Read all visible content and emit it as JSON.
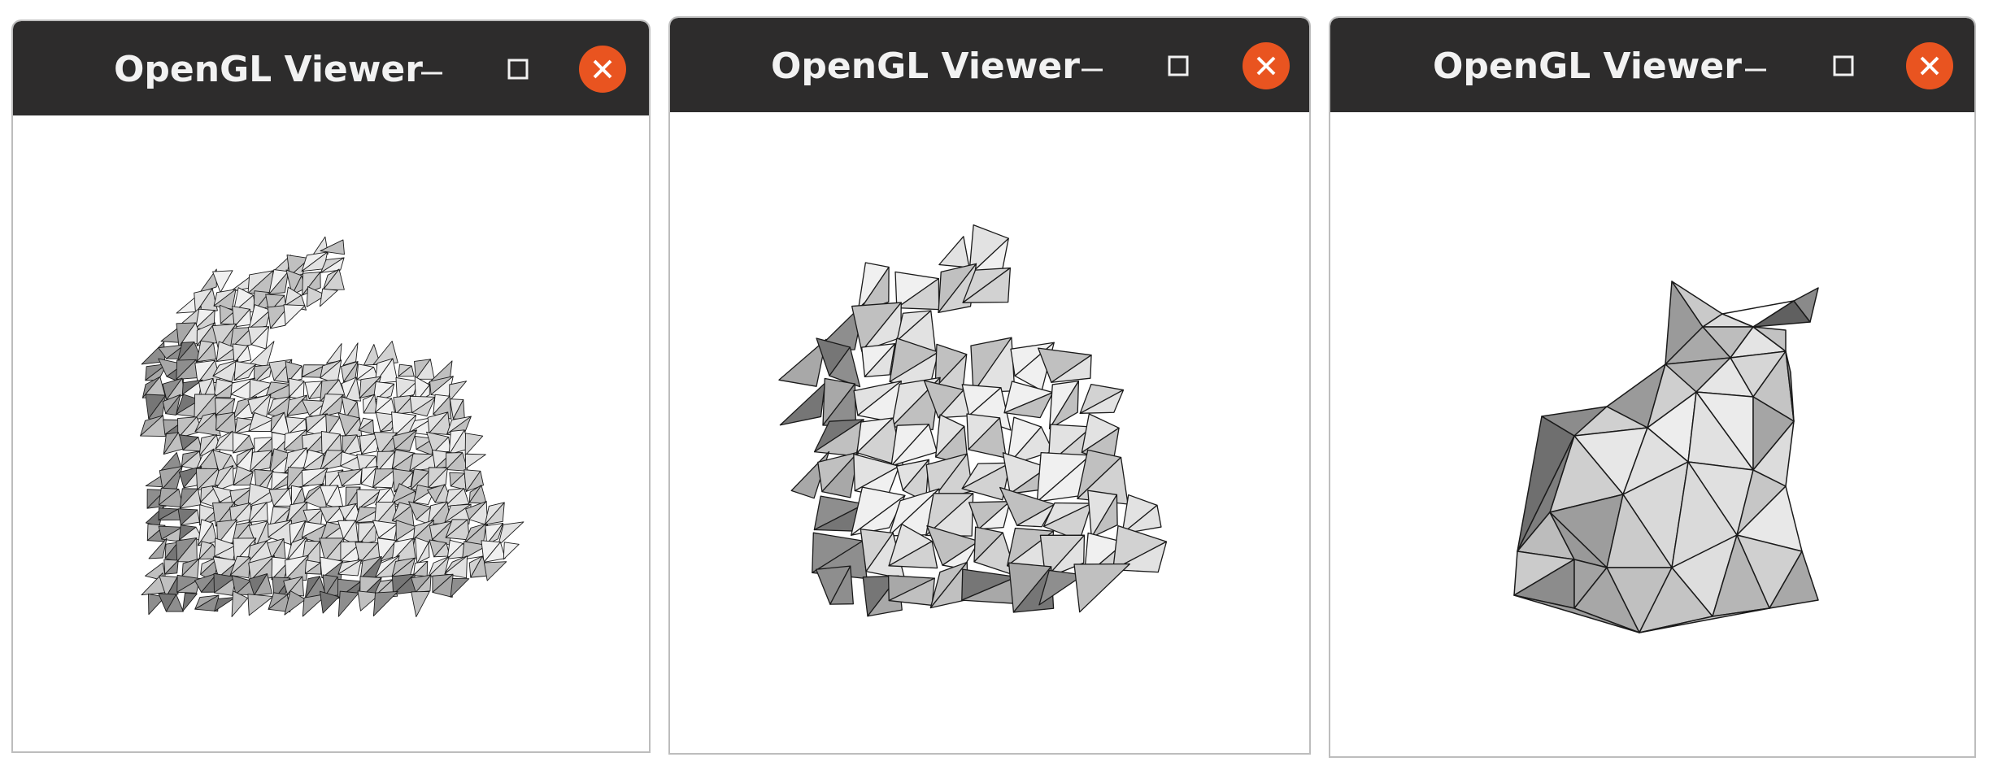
{
  "windows": [
    {
      "title": "OpenGL Viewer",
      "model": "bunny",
      "detail": "high"
    },
    {
      "title": "OpenGL Viewer",
      "model": "bunny",
      "detail": "medium"
    },
    {
      "title": "OpenGL Viewer",
      "model": "bunny",
      "detail": "low"
    }
  ],
  "colors": {
    "titlebar": "#2d2c2c",
    "close": "#e95420",
    "mesh_light": "#ececec",
    "mesh_mid": "#b9b9b9",
    "mesh_dark": "#6d6d6d",
    "edge": "#1a1a1a"
  }
}
